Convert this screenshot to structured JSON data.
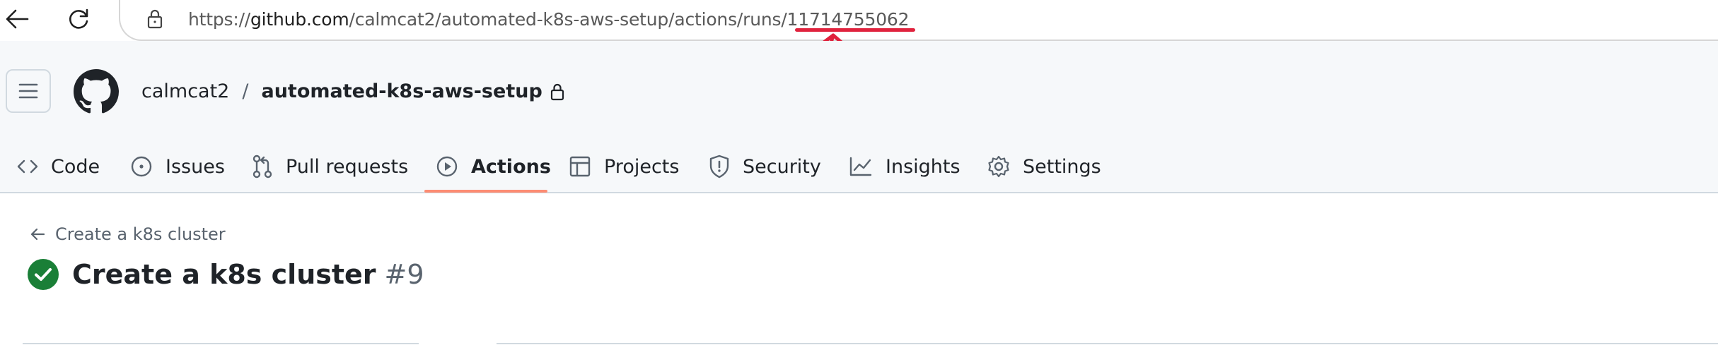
{
  "browser": {
    "url_prefix": "https://",
    "url_host": "github.com",
    "url_path": "/calmcat2/automated-k8s-aws-setup/actions/runs/",
    "url_run_id": "11714755062",
    "annotation_color": "#e0223d"
  },
  "repo": {
    "owner": "calmcat2",
    "separator": "/",
    "name": "automated-k8s-aws-setup"
  },
  "tabs": [
    {
      "label": "Code",
      "icon": "code-icon"
    },
    {
      "label": "Issues",
      "icon": "issue-opened-icon"
    },
    {
      "label": "Pull requests",
      "icon": "git-pull-request-icon"
    },
    {
      "label": "Actions",
      "icon": "play-icon",
      "selected": true
    },
    {
      "label": "Projects",
      "icon": "table-icon"
    },
    {
      "label": "Security",
      "icon": "shield-icon"
    },
    {
      "label": "Insights",
      "icon": "graph-icon"
    },
    {
      "label": "Settings",
      "icon": "gear-icon"
    }
  ],
  "run": {
    "back_label": "Create a k8s cluster",
    "title": "Create a k8s cluster",
    "number": "#9",
    "status": "success",
    "status_color": "#1a7f37"
  },
  "colors": {
    "header_bg": "#f6f8fa",
    "selected_tab_underline": "#fd8c73"
  }
}
